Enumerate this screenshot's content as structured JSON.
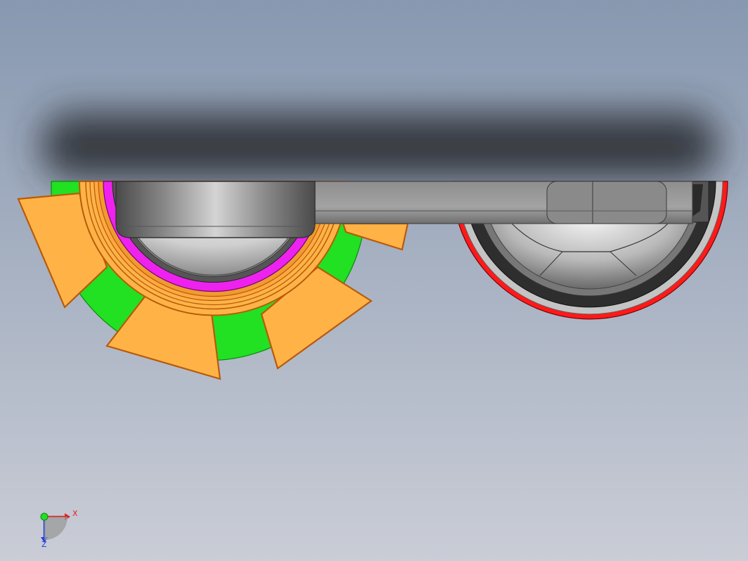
{
  "viewport": {
    "background_top": "#8a9bb3",
    "background_bottom": "#c9ccd6"
  },
  "model": {
    "colors": {
      "gear": "#ffb347",
      "gear_edge": "#b85a0a",
      "green_ring": "#22e022",
      "green_edge": "#0a8a0a",
      "magenta_ring": "#ee22ee",
      "red_ring": "#ff1a1a",
      "steel_dark": "#3a3a3a",
      "steel_light": "#d8d8d8",
      "bar": "#9a9a9a"
    }
  },
  "triad": {
    "x_label": "X",
    "z_label": "Z",
    "y_marker": "Y",
    "x_color": "#e02020",
    "y_color": "#20c020",
    "z_color": "#2040e0"
  }
}
